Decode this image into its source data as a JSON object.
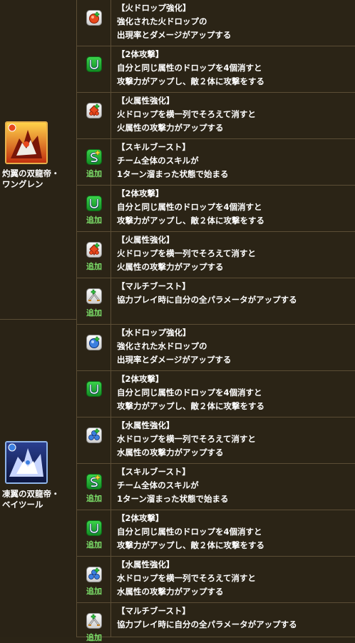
{
  "monsters": [
    {
      "name_line1": "灼翼の双龍帝・",
      "name_line2": "ワングレン",
      "attribute": "fire"
    },
    {
      "name_line1": "凍翼の双龍帝・",
      "name_line2": "ベイツール",
      "attribute": "water"
    }
  ],
  "add_label": "追加",
  "colors": {
    "fire": "#e8491d",
    "water": "#3b7fe0",
    "green": "#2fc23d",
    "text": "#ffffff",
    "add_green": "#7ee36b"
  },
  "rows": [
    {
      "icon": "fire-drop-enhance-icon",
      "added": false,
      "title": "【火ドロップ強化】",
      "line1": "強化された火ドロップの",
      "line2": "出現率とダメージがアップする"
    },
    {
      "icon": "two-pronged-attack-icon",
      "added": false,
      "title": "【2体攻撃】",
      "line1": "自分と同じ属性のドロップを4個消すと",
      "line2": "攻撃力がアップし、敵２体に攻撃をする"
    },
    {
      "icon": "fire-row-enhance-icon",
      "added": false,
      "title": "【火属性強化】",
      "line1": "火ドロップを横一列でそろえて消すと",
      "line2": "火属性の攻撃力がアップする"
    },
    {
      "icon": "skill-boost-icon",
      "added": true,
      "title": "【スキルブースト】",
      "line1": "チーム全体のスキルが",
      "line2": "1ターン溜まった状態で始まる"
    },
    {
      "icon": "two-pronged-attack-icon",
      "added": true,
      "title": "【2体攻撃】",
      "line1": "自分と同じ属性のドロップを4個消すと",
      "line2": "攻撃力がアップし、敵２体に攻撃をする"
    },
    {
      "icon": "fire-row-enhance-icon",
      "added": true,
      "title": "【火属性強化】",
      "line1": "火ドロップを横一列でそろえて消すと",
      "line2": "火属性の攻撃力がアップする"
    },
    {
      "icon": "multi-boost-icon",
      "added": true,
      "title": "【マルチブースト】",
      "line1": "協力プレイ時に自分の全パラメータがアップする",
      "line2": ""
    },
    {
      "icon": "water-drop-enhance-icon",
      "added": false,
      "title": "【水ドロップ強化】",
      "line1": "強化された水ドロップの",
      "line2": "出現率とダメージがアップする"
    },
    {
      "icon": "two-pronged-attack-icon",
      "added": false,
      "title": "【2体攻撃】",
      "line1": "自分と同じ属性のドロップを4個消すと",
      "line2": "攻撃力がアップし、敵２体に攻撃をする"
    },
    {
      "icon": "water-row-enhance-icon",
      "added": false,
      "title": "【水属性強化】",
      "line1": "水ドロップを横一列でそろえて消すと",
      "line2": "水属性の攻撃力がアップする"
    },
    {
      "icon": "skill-boost-icon",
      "added": true,
      "title": "【スキルブースト】",
      "line1": "チーム全体のスキルが",
      "line2": "1ターン溜まった状態で始まる"
    },
    {
      "icon": "two-pronged-attack-icon",
      "added": true,
      "title": "【2体攻撃】",
      "line1": "自分と同じ属性のドロップを4個消すと",
      "line2": "攻撃力がアップし、敵２体に攻撃をする"
    },
    {
      "icon": "water-row-enhance-icon",
      "added": true,
      "title": "【水属性強化】",
      "line1": "水ドロップを横一列でそろえて消すと",
      "line2": "水属性の攻撃力がアップする"
    },
    {
      "icon": "multi-boost-icon",
      "added": true,
      "title": "【マルチブースト】",
      "line1": "協力プレイ時に自分の全パラメータがアップする",
      "line2": ""
    }
  ]
}
